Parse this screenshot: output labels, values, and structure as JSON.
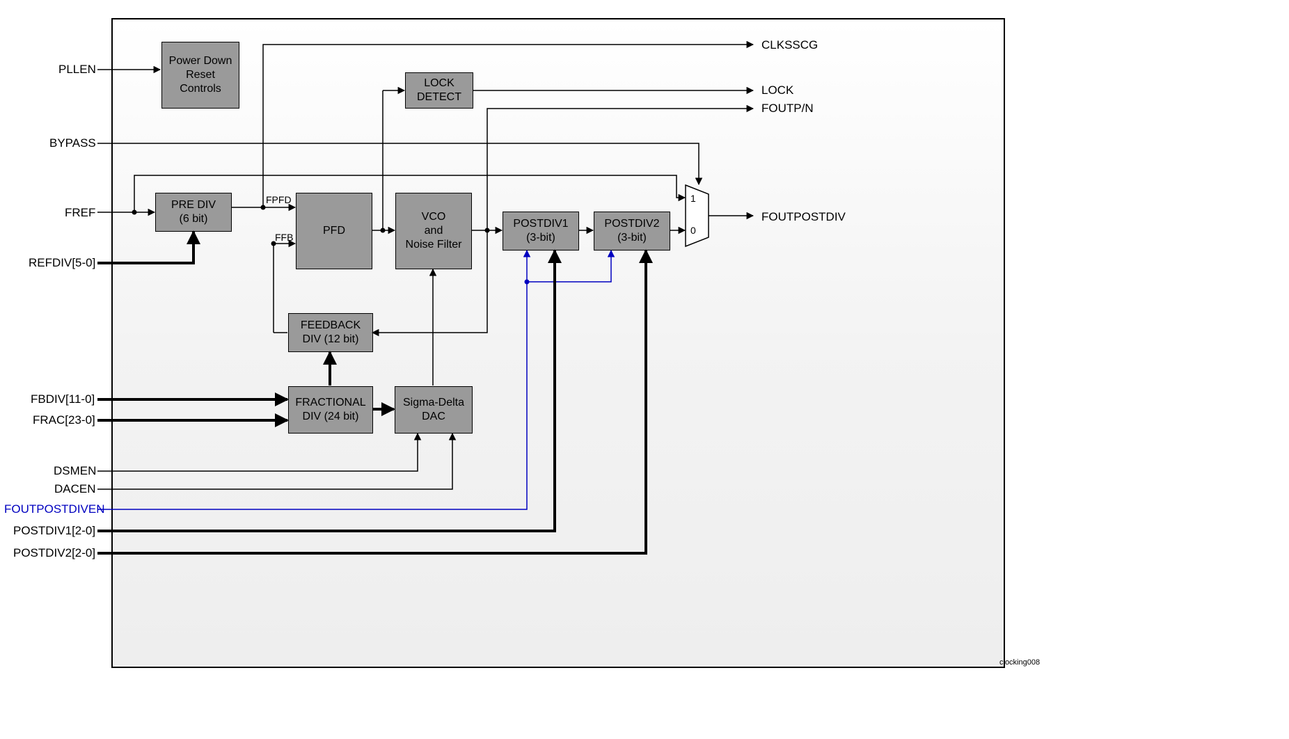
{
  "blocks": {
    "pdr": "Power Down\nReset\nControls",
    "prediv": "PRE DIV\n(6 bit)",
    "pfd": "PFD",
    "vco": "VCO\nand\nNoise Filter",
    "lockdet": "LOCK\nDETECT",
    "postdiv1": "POSTDIV1\n(3-bit)",
    "postdiv2": "POSTDIV2\n(3-bit)",
    "fbdiv": "FEEDBACK\nDIV (12 bit)",
    "fracdiv": "FRACTIONAL\nDIV (24 bit)",
    "sddac": "Sigma-Delta\nDAC"
  },
  "wirelabels": {
    "fpfd": "FPFD",
    "ffb": "FFB"
  },
  "mux": {
    "in1": "1",
    "in0": "0"
  },
  "inputs": {
    "pllen": "PLLEN",
    "bypass": "BYPASS",
    "fref": "FREF",
    "refdiv": "REFDIV[5-0]",
    "fbdiv": "FBDIV[11-0]",
    "frac": "FRAC[23-0]",
    "dsmen": "DSMEN",
    "dacen": "DACEN",
    "foutpostdiven": "FOUTPOSTDIVEN",
    "postdiv1": "POSTDIV1[2-0]",
    "postdiv2": "POSTDIV2[2-0]"
  },
  "outputs": {
    "clksscg": "CLKSSCG",
    "lock": "LOCK",
    "foutpn": "FOUTP/N",
    "foutpostdiv": "FOUTPOSTDIV"
  },
  "footer": "clocking008"
}
